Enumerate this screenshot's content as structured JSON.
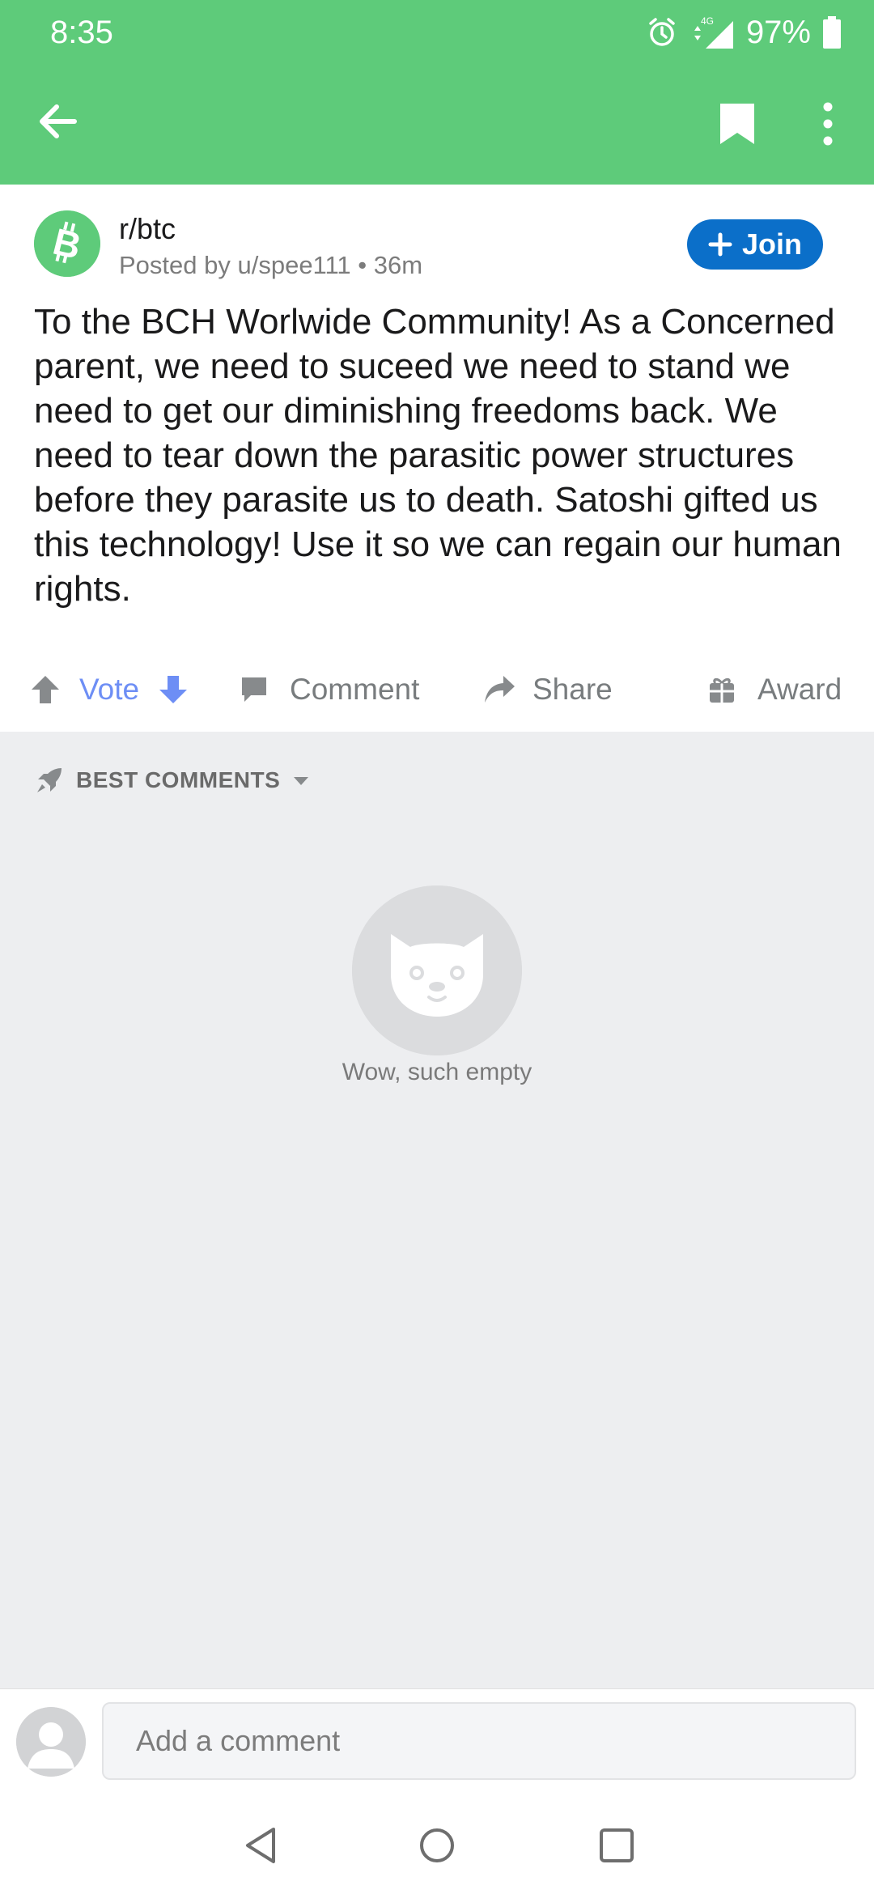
{
  "status_bar": {
    "time": "8:35",
    "network": "4G",
    "battery": "97%"
  },
  "app_bar": {
    "back_icon": "arrow-left-icon",
    "bookmark_icon": "bookmark-icon",
    "more_icon": "more-vertical-icon"
  },
  "post": {
    "subreddit": "r/btc",
    "meta": "Posted by u/spee111 • 36m",
    "join_label": "Join",
    "body": "To the BCH Worlwide Community! As a Concerned parent, we need to suceed we need to stand we need to get our diminishing freedoms back. We need to tear down the parasitic power structures before they parasite us to death. Satoshi gifted us this technology! Use it so we can regain our human rights."
  },
  "actions": {
    "vote_label": "Vote",
    "comment_label": "Comment",
    "share_label": "Share",
    "award_label": "Award"
  },
  "comments": {
    "sort_label": "BEST COMMENTS",
    "empty_text": "Wow, such empty"
  },
  "comment_bar": {
    "placeholder": "Add a comment"
  },
  "colors": {
    "brand_green": "#5ecb7a",
    "join_blue": "#0b6fc9",
    "vote_blue": "#6d8ef5",
    "comments_bg": "#edeef0"
  }
}
